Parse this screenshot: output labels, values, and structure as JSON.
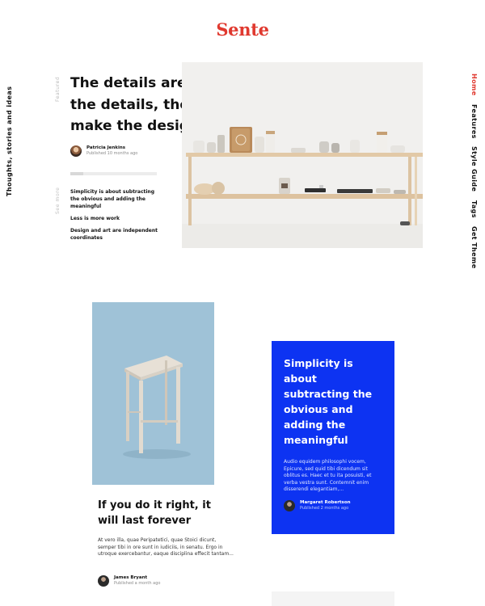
{
  "brand": {
    "logo": "Sente",
    "accent": "#e0392f"
  },
  "tagline": "Thoughts, stories and ideas",
  "nav": {
    "items": [
      {
        "label": "Home",
        "active": true
      },
      {
        "label": "Features"
      },
      {
        "label": "Style Guide"
      },
      {
        "label": "Tags"
      },
      {
        "label": "Get Theme"
      }
    ]
  },
  "featured": {
    "section_label": "Featured",
    "title": "The details are not the details, they make the design",
    "author": {
      "name": "Patricia Jenkins",
      "date": "Published 10 months ago"
    },
    "progress": 0.15
  },
  "see_more": {
    "label": "See more",
    "items": [
      "Simplicity is about subtracting the obvious and adding the meaningful",
      "Less is more work",
      "Design and art are independent coordinates"
    ]
  },
  "card_stool": {
    "title": "If you do it right, it will last forever",
    "excerpt": "At vero illa, quae Peripatetici, quae Stoici dicunt, semper tibi in ore sunt in iudiciis, in senatu. Ergo in utroque exercebantur, eaque disciplina effecit tantam...",
    "author": {
      "name": "James Bryant",
      "date": "Published a month ago"
    }
  },
  "card_blue": {
    "title": "Simplicity is about subtracting the obvious and adding the meaningful",
    "excerpt": "Audio equidem philosophi vocem, Epicure, sed quid tibi dicendum sit oblitus es. Haec et tu ita posuisti, et verba vestra sunt. Contemnit enim disserendi elegantiam,...",
    "author": {
      "name": "Margaret Robertson",
      "date": "Published 2 months ago"
    },
    "color": "#0d33f2"
  }
}
